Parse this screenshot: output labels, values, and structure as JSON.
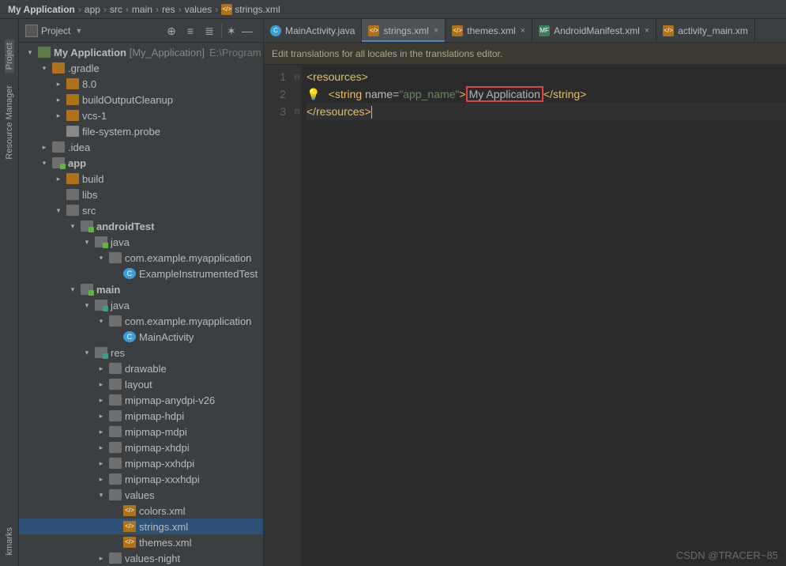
{
  "breadcrumbs": {
    "root": "My Application",
    "items": [
      "app",
      "src",
      "main",
      "res",
      "values"
    ],
    "file": "strings.xml"
  },
  "left_rail": {
    "project": "Project",
    "res_mgr": "Resource Manager",
    "bookmarks": "kmarks"
  },
  "project_panel": {
    "title": "Project"
  },
  "tree": {
    "root": {
      "name": "My Application",
      "alt": "[My_Application]",
      "path": "E:\\Program"
    },
    "gradle": ".gradle",
    "gradle_80": "8.0",
    "buildOutputCleanup": "buildOutputCleanup",
    "vcs1": "vcs-1",
    "probe": "file-system.probe",
    "idea": ".idea",
    "app": "app",
    "build": "build",
    "libs": "libs",
    "src": "src",
    "androidTest": "androidTest",
    "at_java": "java",
    "at_pkg": "com.example.myapplication",
    "at_class": "ExampleInstrumentedTest",
    "main": "main",
    "main_java": "java",
    "main_pkg": "com.example.myapplication",
    "main_class": "MainActivity",
    "res": "res",
    "drawable": "drawable",
    "layout": "layout",
    "mipmap_any": "mipmap-anydpi-v26",
    "mipmap_hdpi": "mipmap-hdpi",
    "mipmap_mdpi": "mipmap-mdpi",
    "mipmap_xhdpi": "mipmap-xhdpi",
    "mipmap_xxhdpi": "mipmap-xxhdpi",
    "mipmap_xxxhdpi": "mipmap-xxxhdpi",
    "values": "values",
    "colors": "colors.xml",
    "strings": "strings.xml",
    "themes": "themes.xml",
    "values_night": "values-night"
  },
  "tabs": [
    {
      "label": "MainActivity.java",
      "type": "java"
    },
    {
      "label": "strings.xml",
      "type": "xml"
    },
    {
      "label": "themes.xml",
      "type": "xml"
    },
    {
      "label": "AndroidManifest.xml",
      "type": "mf"
    },
    {
      "label": "activity_main.xm",
      "type": "xml"
    }
  ],
  "editor": {
    "banner": "Edit translations for all locales in the translations editor.",
    "line_numbers": [
      "1",
      "2",
      "3"
    ],
    "code": {
      "l1_open": "<resources>",
      "l2_prefix": "<string",
      "l2_attr_name": " name=",
      "l2_attr_val": "\"app_name\"",
      "l2_gt": ">",
      "l2_content": "My Application",
      "l2_close": "</string>",
      "l3_close": "</resources>"
    }
  },
  "watermark": "CSDN @TRACER~85"
}
